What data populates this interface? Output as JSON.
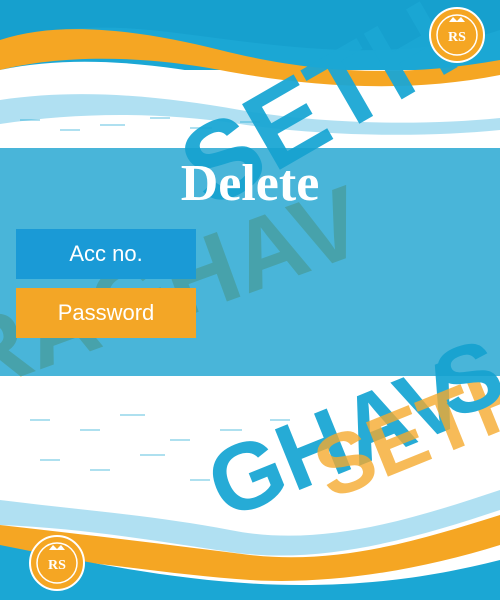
{
  "page": {
    "title": "Delete"
  },
  "form": {
    "account_label": "Acc no.",
    "password_label": "Password"
  },
  "decor": {
    "watermark_words": [
      "RAGHAV",
      "SETHI",
      "GHAV",
      "SETH",
      "S"
    ],
    "logo_text": "RS",
    "colors": {
      "band": "#16a0ce",
      "accent_orange": "#f3a626",
      "accent_blue": "#1a9ad6",
      "wave_blue": "#1ba7d4",
      "wave_orange": "#f5a623"
    }
  }
}
